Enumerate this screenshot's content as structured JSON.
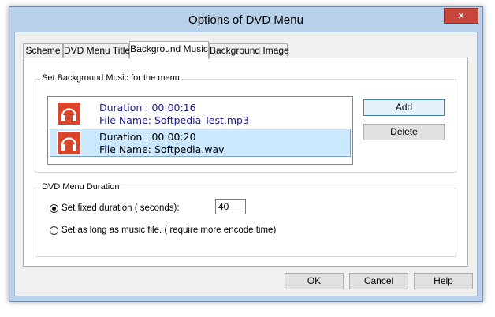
{
  "window": {
    "title": "Options of DVD Menu",
    "close_glyph": "✕"
  },
  "tabs": [
    {
      "label": "Scheme"
    },
    {
      "label": "DVD Menu Title"
    },
    {
      "label": "Background Music"
    },
    {
      "label": "Background Image"
    }
  ],
  "active_tab": "Background Music",
  "music_group": {
    "label": "Set Background Music for the menu",
    "items": [
      {
        "duration": "Duration : 00:00:16",
        "file": "File Name: Softpedia Test.mp3",
        "icon": "headphones-icon",
        "selected": false
      },
      {
        "duration": "Duration : 00:00:20",
        "file": "File Name: Softpedia.wav",
        "icon": "headphones-icon",
        "selected": true
      }
    ],
    "add_label": "Add",
    "delete_label": "Delete"
  },
  "duration_group": {
    "label": "DVD Menu Duration",
    "fixed_label": "Set fixed duration ( seconds):",
    "fixed_value": "40",
    "fixed_checked": true,
    "music_label": "Set as long as music file. ( require more encode time)",
    "music_checked": false
  },
  "footer": {
    "ok_label": "OK",
    "cancel_label": "Cancel",
    "help_label": "Help"
  },
  "colors": {
    "frame": "#b9d1ea",
    "close": "#c7463b",
    "icon_bg": "#d9442b",
    "selection": "#cce8ff",
    "item_text": "#1c1c8a"
  }
}
